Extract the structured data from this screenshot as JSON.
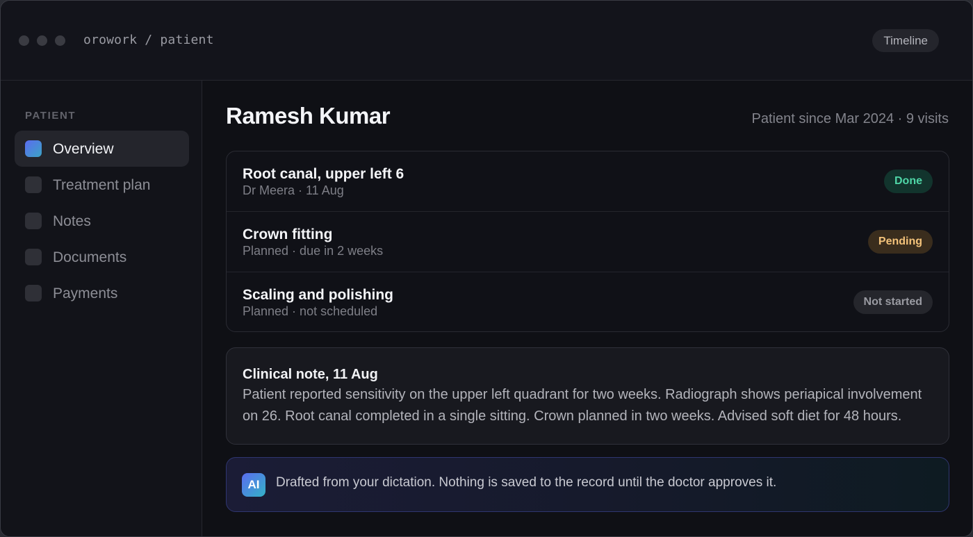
{
  "header": {
    "breadcrumb": "orowork / patient",
    "timeline_label": "Timeline"
  },
  "sidebar": {
    "heading": "PATIENT",
    "items": [
      {
        "label": "Overview",
        "active": true
      },
      {
        "label": "Treatment plan",
        "active": false
      },
      {
        "label": "Notes",
        "active": false
      },
      {
        "label": "Documents",
        "active": false
      },
      {
        "label": "Payments",
        "active": false
      }
    ]
  },
  "patient": {
    "name": "Ramesh Kumar",
    "meta": "Patient since Mar 2024 · 9 visits"
  },
  "treatments": [
    {
      "title": "Root canal, upper left 6",
      "subtitle": "Dr Meera · 11 Aug",
      "status": "Done"
    },
    {
      "title": "Crown fitting",
      "subtitle": "Planned · due in 2 weeks",
      "status": "Pending"
    },
    {
      "title": "Scaling and polishing",
      "subtitle": "Planned · not scheduled",
      "status": "Not started"
    }
  ],
  "note": {
    "title": "Clinical note, 11 Aug",
    "body": "Patient reported sensitivity on the upper left quadrant for two weeks. Radiograph shows periapical involvement on 26. Root canal completed in a single sitting. Crown planned in two weeks. Advised soft diet for 48 hours."
  },
  "ai_notice": {
    "badge": "AI",
    "text": "Drafted from your dictation. Nothing is saved to the record until the doctor approves it."
  },
  "colors": {
    "accent_gradient_start": "#5b6cf0",
    "accent_gradient_end": "#3ba3c4",
    "status_done": "#4fd6a7",
    "status_pending": "#f3c27a",
    "status_not_started": "#9a9ba2"
  }
}
